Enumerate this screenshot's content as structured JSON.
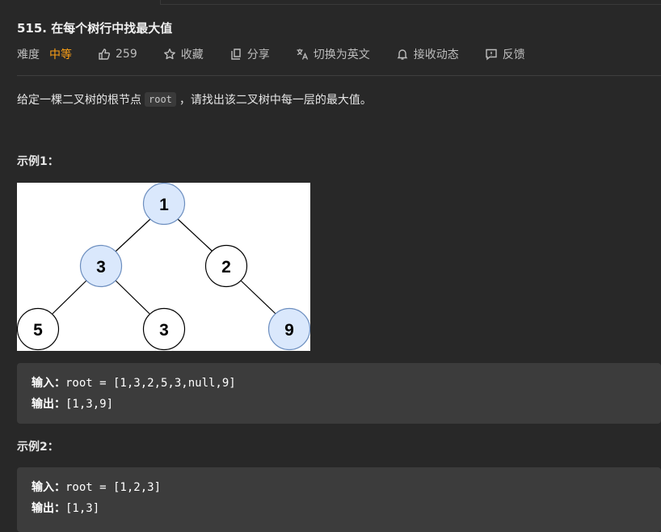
{
  "problem": {
    "title": "515. 在每个树行中找最大值",
    "difficulty_label": "难度",
    "difficulty": "中等",
    "likes": "259",
    "favorite": "收藏",
    "share": "分享",
    "switch_lang": "切换为英文",
    "subscribe": "接收动态",
    "feedback": "反馈",
    "colors": {
      "difficulty": "#ffa116",
      "highlight_node": "#dae8fc"
    }
  },
  "description": {
    "prefix": "给定一棵二叉树的根节点",
    "code": "root",
    "suffix": "，请找出该二叉树中每一层的最大值。"
  },
  "example1": {
    "heading": "示例1：",
    "tree_nodes": [
      "1",
      "3",
      "2",
      "5",
      "3",
      "9"
    ],
    "input_label": "输入：",
    "input": "root = [1,3,2,5,3,null,9]",
    "output_label": "输出：",
    "output": "[1,3,9]"
  },
  "example2": {
    "heading": "示例2：",
    "input_label": "输入：",
    "input": "root = [1,2,3]",
    "output_label": "输出：",
    "output": "[1,3]"
  }
}
